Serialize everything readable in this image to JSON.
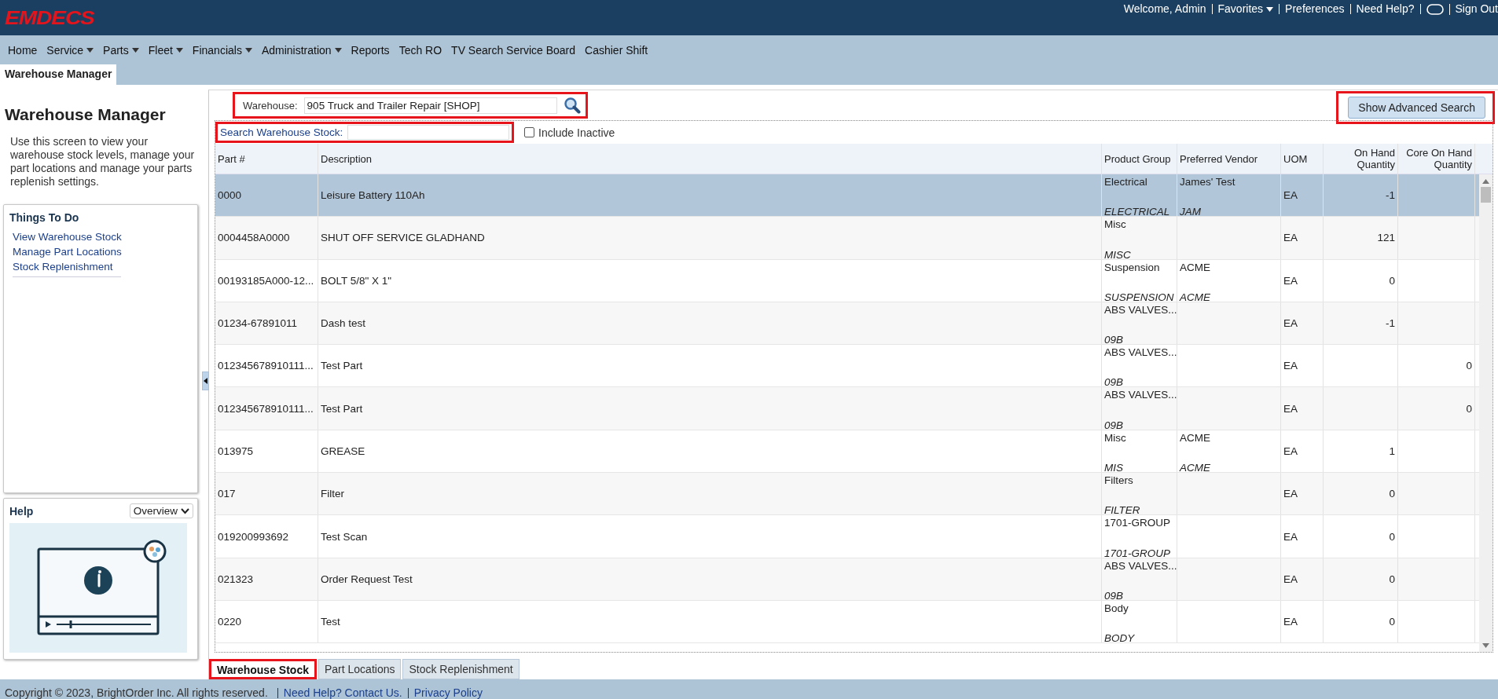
{
  "header": {
    "logo": "EMDECS",
    "user_menu": [
      {
        "label": "Welcome, Admin",
        "kind": "text"
      },
      {
        "label": "Favorites",
        "kind": "menu"
      },
      {
        "label": "Preferences",
        "kind": "link"
      },
      {
        "label": "Need Help?",
        "kind": "link"
      },
      {
        "kind": "chat"
      },
      {
        "label": "Sign Out",
        "kind": "link"
      }
    ]
  },
  "nav": [
    {
      "label": "Home",
      "has_menu": false
    },
    {
      "label": "Service",
      "has_menu": true
    },
    {
      "label": "Parts",
      "has_menu": true
    },
    {
      "label": "Fleet",
      "has_menu": true
    },
    {
      "label": "Financials",
      "has_menu": true
    },
    {
      "label": "Administration",
      "has_menu": true
    },
    {
      "label": "Reports",
      "has_menu": false
    },
    {
      "label": "Tech RO",
      "has_menu": false
    },
    {
      "label": "TV Search Service Board",
      "has_menu": false
    },
    {
      "label": "Cashier Shift",
      "has_menu": false
    }
  ],
  "page_tabs": [
    {
      "label": "Warehouse Manager",
      "selected": true
    }
  ],
  "sidebar": {
    "title": "Warehouse Manager",
    "description": "Use this screen to view your warehouse stock levels, manage your part locations and manage your parts replenish settings.",
    "things_to_do": {
      "title": "Things To Do",
      "links": [
        "View Warehouse Stock",
        "Manage Part Locations",
        "Stock Replenishment"
      ]
    },
    "help": {
      "title": "Help",
      "dropdown": "Overview"
    }
  },
  "search": {
    "warehouse_label": "Warehouse:",
    "warehouse_value": "905 Truck and Trailer Repair [SHOP]",
    "warehouse_highlighted": true,
    "advanced_button": "Show Advanced Search",
    "advanced_highlighted": true,
    "stock_label": "Search Warehouse Stock:",
    "stock_highlighted": true,
    "include_inactive": {
      "label": "Include Inactive",
      "checked": false
    }
  },
  "table": {
    "columns": [
      "Part #",
      "Description",
      "Product Group",
      "Preferred Vendor",
      "UOM",
      "On Hand Quantity",
      "Core On Hand Quantity"
    ],
    "rows": [
      {
        "part": "0000",
        "description": "Leisure Battery 110Ah",
        "product_group": "Electrical",
        "product_group_code": "ELECTRICAL",
        "vendor": "James' Test",
        "vendor_code": "JAM",
        "uom": "EA",
        "on_hand": "-1",
        "selected": true
      },
      {
        "part": "0004458A0000",
        "description": "SHUT OFF SERVICE GLADHAND",
        "product_group": "Misc",
        "product_group_code": "MISC",
        "uom": "EA",
        "on_hand": "121",
        "selected": false
      },
      {
        "part": "00193185A000-12...",
        "description": "BOLT 5/8\" X 1\"",
        "product_group": "Suspension",
        "product_group_code": "SUSPENSION",
        "vendor": "ACME",
        "vendor_code": "ACME",
        "uom": "EA",
        "on_hand": "0",
        "selected": false
      },
      {
        "part": "01234-67891011",
        "description": "Dash test",
        "product_group": "ABS VALVES...",
        "product_group_code": "09B",
        "uom": "EA",
        "on_hand": "-1",
        "selected": false
      },
      {
        "part": "012345678910111...",
        "description": "Test Part",
        "product_group": "ABS VALVES...",
        "product_group_code": "09B",
        "uom": "EA",
        "core_on_hand": "0",
        "selected": false
      },
      {
        "part": "012345678910111...",
        "description": "Test Part",
        "product_group": "ABS VALVES...",
        "product_group_code": "09B",
        "uom": "EA",
        "core_on_hand": "0",
        "selected": false
      },
      {
        "part": "013975",
        "description": "GREASE",
        "product_group": "Misc",
        "product_group_code": "MIS",
        "vendor": "ACME",
        "vendor_code": "ACME",
        "uom": "EA",
        "on_hand": "1",
        "selected": false
      },
      {
        "part": "017",
        "description": "Filter",
        "product_group": "Filters",
        "product_group_code": "FILTER",
        "uom": "EA",
        "on_hand": "0",
        "selected": false
      },
      {
        "part": "019200993692",
        "description": "Test Scan",
        "product_group": "1701-GROUP",
        "product_group_code": "1701-GROUP",
        "uom": "EA",
        "on_hand": "0",
        "selected": false
      },
      {
        "part": "021323",
        "description": "Order Request Test",
        "product_group": "ABS VALVES...",
        "product_group_code": "09B",
        "uom": "EA",
        "on_hand": "0",
        "selected": false
      },
      {
        "part": "0220",
        "description": "Test",
        "product_group": "Body",
        "product_group_code": "BODY",
        "uom": "EA",
        "on_hand": "0",
        "selected": false
      }
    ]
  },
  "bottom_tabs": [
    {
      "label": "Warehouse Stock",
      "selected": true,
      "highlighted": true
    },
    {
      "label": "Part Locations",
      "selected": false,
      "highlighted": false
    },
    {
      "label": "Stock Replenishment",
      "selected": false,
      "highlighted": false
    }
  ],
  "footer": {
    "copyright": "Copyright © 2023, BrightOrder Inc. All rights reserved.",
    "links": [
      "Need Help? Contact Us.",
      "Privacy Policy"
    ]
  }
}
